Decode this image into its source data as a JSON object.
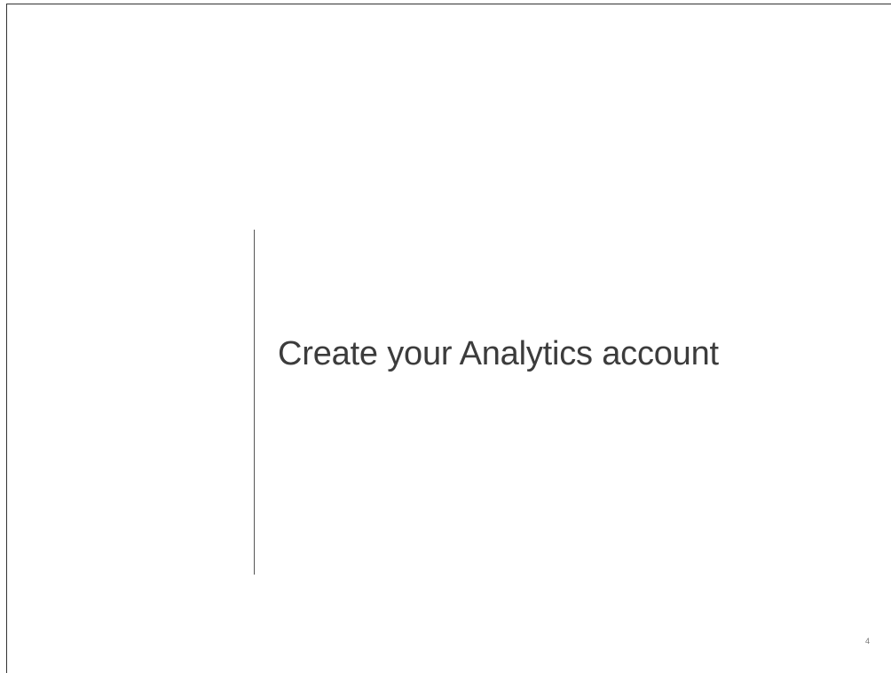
{
  "slide": {
    "title": "Create your Analytics account",
    "page_number": "4"
  },
  "colors": {
    "background": "#ffffff",
    "title_text": "#3c3c3c",
    "divider": "#555555",
    "frame_border": "#333333"
  }
}
